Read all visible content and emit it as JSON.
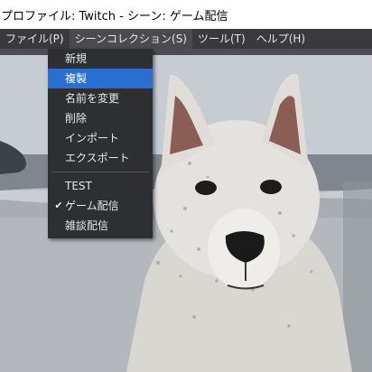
{
  "window": {
    "title": "プロファイル: Twitch - シーン: ゲーム配信"
  },
  "menubar": {
    "items": [
      {
        "label": "ファイル(P)"
      },
      {
        "label": "シーンコレクション(S)",
        "active": true
      },
      {
        "label": "ツール(T)"
      },
      {
        "label": "ヘルプ(H)"
      }
    ]
  },
  "dropdown": {
    "items": [
      {
        "label": "新規"
      },
      {
        "label": "複製",
        "highlighted": true
      },
      {
        "label": "名前を変更"
      },
      {
        "label": "削除"
      },
      {
        "label": "インポート"
      },
      {
        "label": "エクスポート"
      },
      {
        "label": "TEST"
      },
      {
        "label": "ゲーム配信",
        "checked": true
      },
      {
        "label": "雑談配信"
      }
    ],
    "check_glyph": "✔"
  },
  "colors": {
    "highlight": "#2a6fcf",
    "menu_bg": "#2e2f33",
    "menubar_bg": "#3a3a3e"
  }
}
